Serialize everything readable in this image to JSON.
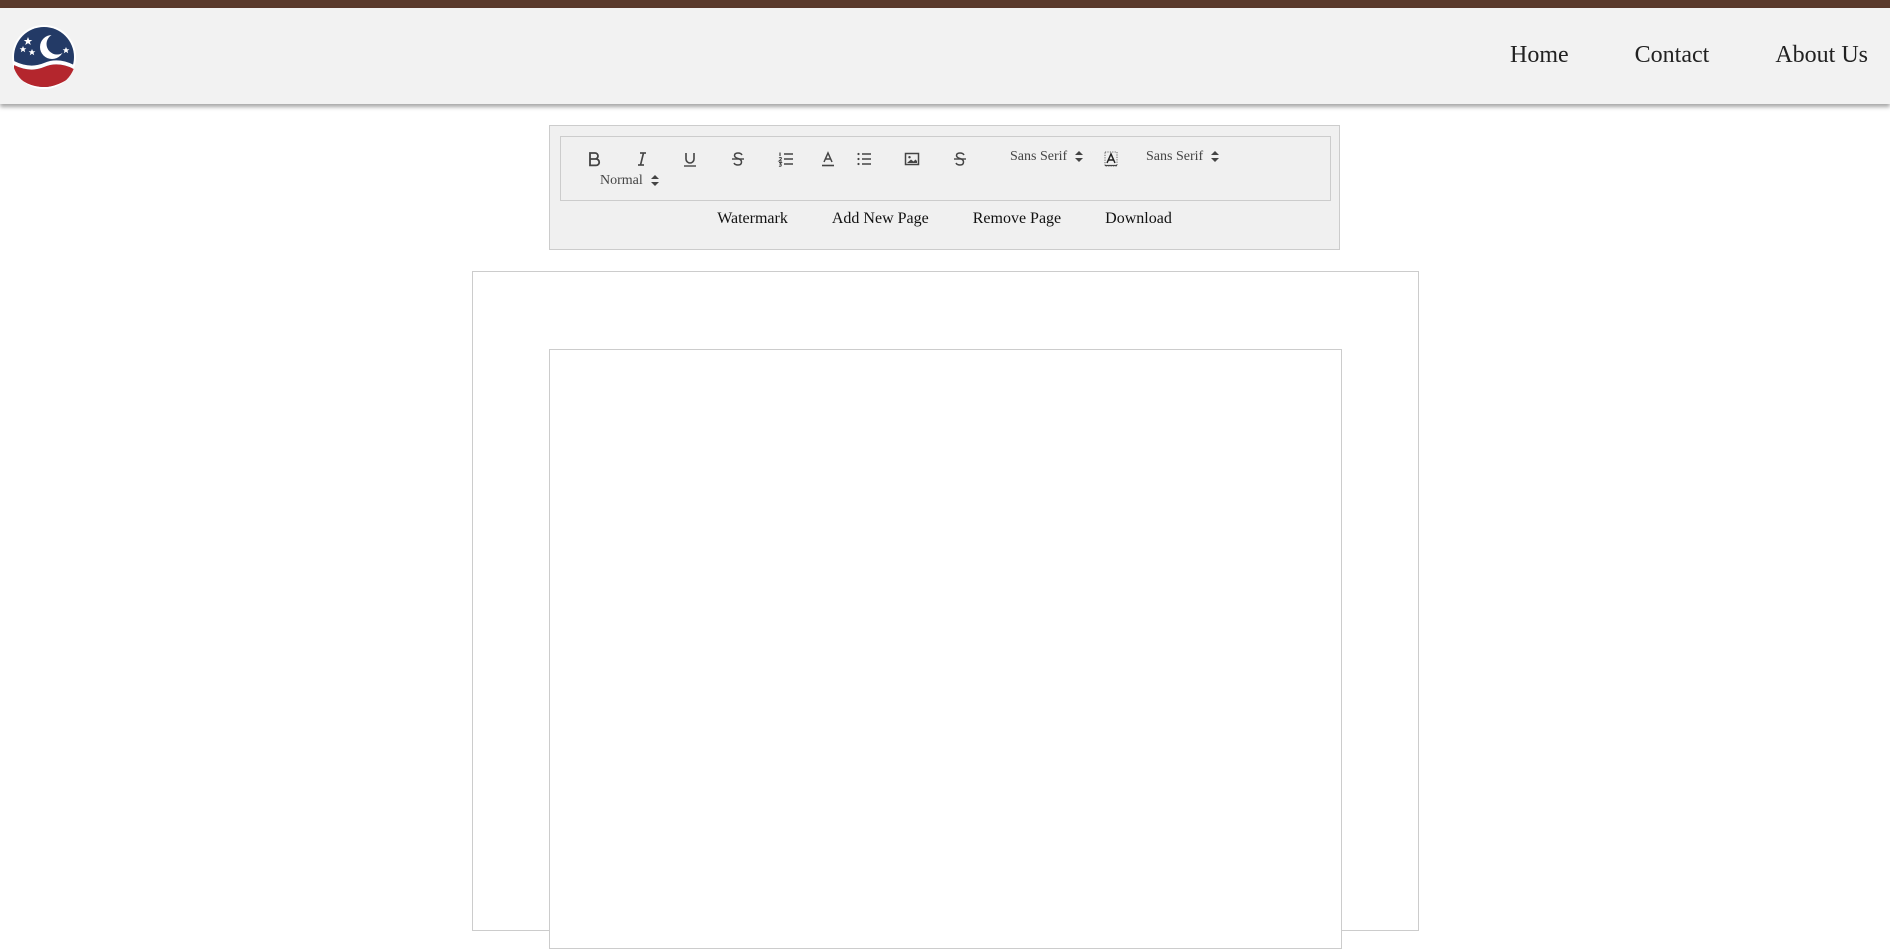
{
  "nav": {
    "home": "Home",
    "contact": "Contact",
    "about": "About Us"
  },
  "toolbar": {
    "font_picker_1": "Sans Serif",
    "font_picker_2": "Sans Serif",
    "size_picker": "Normal",
    "icons": [
      "bold-icon",
      "italic-icon",
      "underline-icon",
      "strike-icon",
      "ordered-list-icon",
      "text-color-icon",
      "bullet-list-icon",
      "image-icon",
      "strike-icon",
      "background-color-icon"
    ]
  },
  "actions": {
    "watermark": "Watermark",
    "add_page": "Add New Page",
    "remove_page": "Remove Page",
    "download": "Download"
  },
  "colors": {
    "top_bar": "#5a3a2c",
    "header_bg": "#f2f2f2",
    "logo_navy": "#233a66",
    "logo_red": "#b4262d"
  }
}
